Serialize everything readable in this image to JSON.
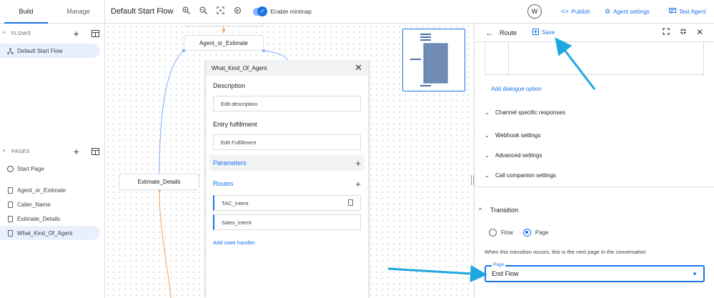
{
  "sidebar": {
    "tabs": [
      {
        "label": "Build"
      },
      {
        "label": "Manage"
      }
    ],
    "flows": {
      "heading": "FLOWS",
      "items": [
        {
          "label": "Default Start Flow"
        }
      ]
    },
    "pages": {
      "heading": "PAGES",
      "items": [
        {
          "label": "Start Page"
        },
        {
          "label": "Agent_or_Estimate"
        },
        {
          "label": "Caller_Name"
        },
        {
          "label": "Estimate_Details"
        },
        {
          "label": "What_Kind_Of_Agent"
        }
      ]
    }
  },
  "toolbar": {
    "flow_title": "Default Start Flow",
    "minimap_label": "Enable minimap",
    "avatar_letter": "W",
    "publish": "Publish",
    "agent_settings": "Agent settings",
    "test_agent": "Test Agent"
  },
  "canvas": {
    "nodes": {
      "agent_or_estimate": "Agent_or_Estimate",
      "estimate_details": "Estimate_Details"
    },
    "page_panel": {
      "title": "What_Kind_Of_Agent",
      "description_label": "Description",
      "description_button": "Edit description",
      "entry_label": "Entry fulfillment",
      "entry_button": "Edit Fulfillment",
      "parameters_label": "Parameters",
      "routes_label": "Routes",
      "routes": [
        {
          "label": "TAC_Intent"
        },
        {
          "label": "Sales_Intent"
        }
      ],
      "add_state_handler": "Add state handler"
    }
  },
  "route_panel": {
    "title": "Route",
    "save_label": "Save",
    "add_dialogue_option": "Add dialogue option",
    "sections": [
      {
        "label": "Channel specific responses"
      },
      {
        "label": "Webhook settings"
      },
      {
        "label": "Advanced settings"
      },
      {
        "label": "Call companion settings"
      }
    ],
    "transition": {
      "heading": "Transition",
      "option_flow": "Flow",
      "option_page": "Page",
      "selected": "Page",
      "helper": "When this transition occurs, this is the next page in the conversation",
      "field_label": "Page",
      "field_value": "End Flow"
    }
  },
  "colors": {
    "accent": "#1a73e8",
    "edge_blue": "#7baaf7",
    "edge_orange": "#f4a261",
    "annotation_arrow": "#1ea7e1"
  }
}
